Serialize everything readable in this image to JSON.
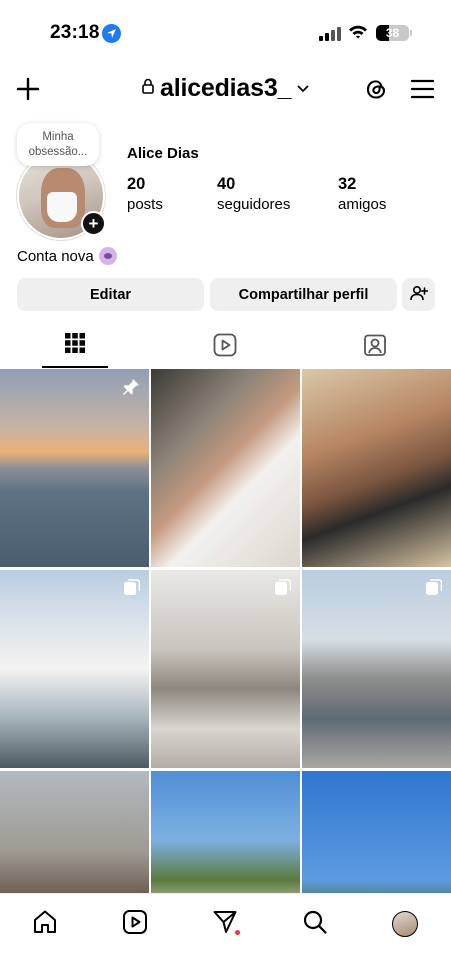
{
  "status_bar": {
    "time": "23:18",
    "battery": "38",
    "battery_level": 0.38,
    "location_icon": "location-arrow-icon",
    "signal_icon": "cellular-signal-icon",
    "wifi_icon": "wifi-icon"
  },
  "header": {
    "username": "alicedias3_",
    "new_post_icon": "plus-icon",
    "lock_icon": "lock-icon",
    "dropdown_icon": "chevron-down-icon",
    "threads_icon": "threads-icon",
    "menu_icon": "hamburger-menu-icon"
  },
  "profile": {
    "note": "Minha obsessão...",
    "display_name": "Alice Dias",
    "bio": "Conta nova",
    "bio_emoji": "shrug-emoji",
    "stats": [
      {
        "value": "20",
        "label": "posts"
      },
      {
        "value": "40",
        "label": "seguidores"
      },
      {
        "value": "32",
        "label": "amigos"
      }
    ]
  },
  "actions": {
    "edit_label": "Editar",
    "share_label": "Compartilhar perfil",
    "add_friend_icon": "add-person-icon"
  },
  "tabs": [
    {
      "name": "grid",
      "icon": "grid-icon",
      "active": true
    },
    {
      "name": "reels",
      "icon": "reels-icon",
      "active": false
    },
    {
      "name": "tagged",
      "icon": "tagged-person-icon",
      "active": false
    }
  ],
  "grid": {
    "posts": [
      {
        "kind": "photo",
        "badge": "pin-icon"
      },
      {
        "kind": "photo",
        "badge": ""
      },
      {
        "kind": "photo",
        "badge": ""
      },
      {
        "kind": "carousel",
        "badge": "carousel-icon"
      },
      {
        "kind": "carousel",
        "badge": "carousel-icon"
      },
      {
        "kind": "carousel",
        "badge": "carousel-icon"
      },
      {
        "kind": "photo",
        "badge": ""
      },
      {
        "kind": "photo",
        "badge": ""
      },
      {
        "kind": "photo",
        "badge": ""
      }
    ]
  },
  "bottom_nav": [
    {
      "name": "home",
      "icon": "home-icon"
    },
    {
      "name": "reels",
      "icon": "reels-icon"
    },
    {
      "name": "direct",
      "icon": "paper-plane-icon",
      "notification": true
    },
    {
      "name": "search",
      "icon": "search-icon"
    },
    {
      "name": "profile",
      "icon": "profile-avatar-icon"
    }
  ]
}
